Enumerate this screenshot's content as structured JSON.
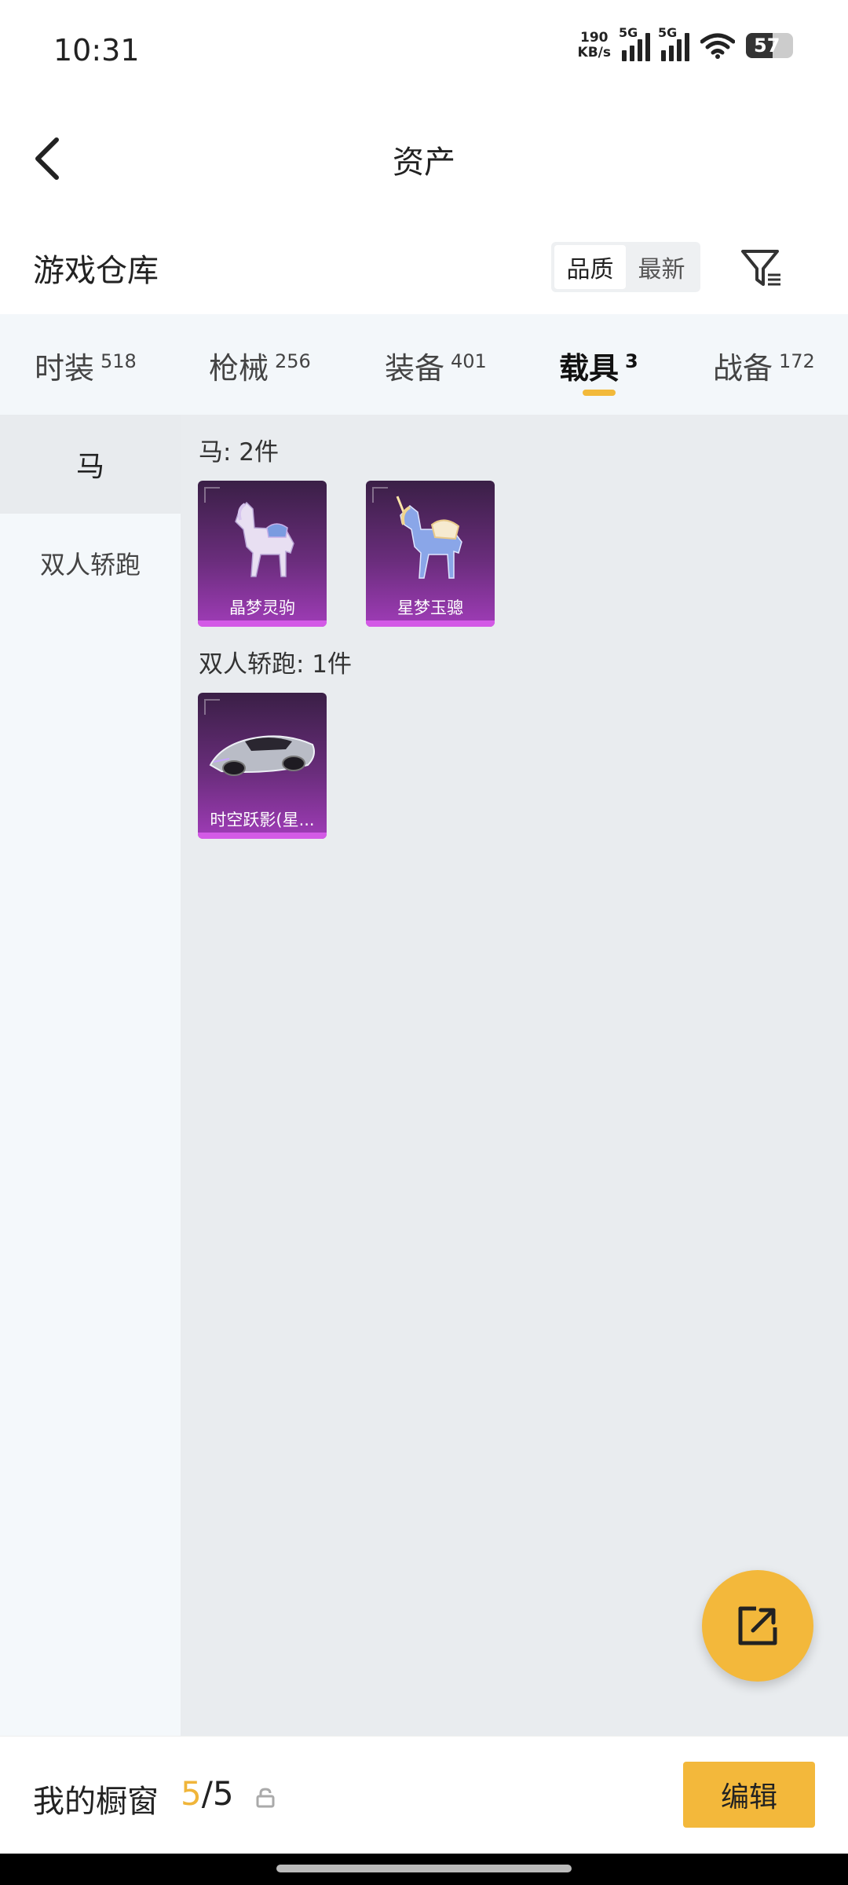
{
  "status_bar": {
    "time": "10:31",
    "net_speed_value": "190",
    "net_speed_unit": "KB/s",
    "signal_1_tag": "5G",
    "signal_2_tag": "5G",
    "battery": "57"
  },
  "header": {
    "title": "资产"
  },
  "warehouse": {
    "title": "游戏仓库",
    "sort_options": [
      "品质",
      "最新"
    ],
    "active_sort": "品质"
  },
  "tabs": [
    {
      "label": "时装",
      "count": "518"
    },
    {
      "label": "枪械",
      "count": "256"
    },
    {
      "label": "装备",
      "count": "401"
    },
    {
      "label": "载具",
      "count": "3",
      "active": true
    },
    {
      "label": "战备",
      "count": "172"
    }
  ],
  "side_nav": [
    {
      "label": "马",
      "active": true
    },
    {
      "label": "双人轿跑",
      "active": false
    }
  ],
  "groups": [
    {
      "title": "马: 2件",
      "items": [
        {
          "name": "晶梦灵驹",
          "icon": "white-horse-icon"
        },
        {
          "name": "星梦玉骢",
          "icon": "unicorn-icon"
        }
      ]
    },
    {
      "title": "双人轿跑: 1件",
      "items": [
        {
          "name": "时空跃影(星...",
          "icon": "sports-car-icon"
        }
      ]
    }
  ],
  "showcase": {
    "label": "我的橱窗",
    "current": "5",
    "separator": "/",
    "total": "5",
    "edit_label": "编辑"
  },
  "colors": {
    "accent": "#f3b83b",
    "item_card_purple": "#6a2d7c",
    "item_card_bar": "#d35ae6"
  }
}
